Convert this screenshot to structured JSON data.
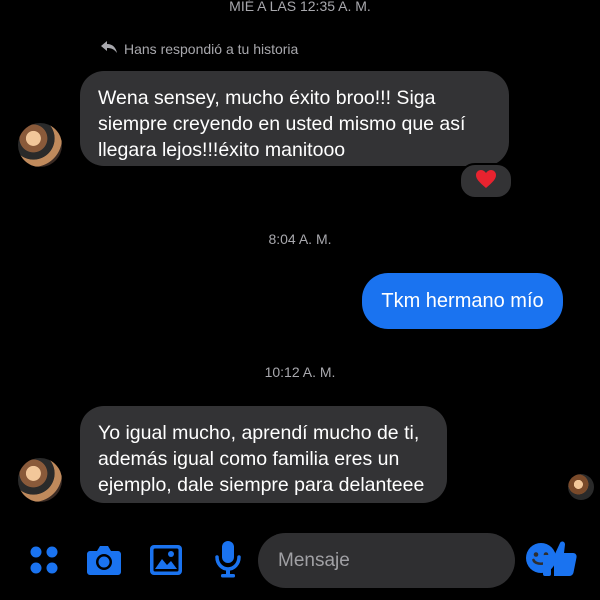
{
  "thread": {
    "top_timestamp": "MIÉ A LAS 12:35 A. M.",
    "reply_note": "Hans respondió a tu historia",
    "timestamp_2": "8:04 A. M.",
    "timestamp_3": "10:12 A. M."
  },
  "messages": [
    {
      "direction": "incoming",
      "text": "Wena sensey, mucho éxito broo!!! Siga siempre creyendo en usted mismo que así llegara lejos!!!éxito manitooo",
      "reaction": "heart"
    },
    {
      "direction": "outgoing",
      "text": "Tkm hermano mío"
    },
    {
      "direction": "incoming",
      "text": "Yo igual mucho, aprendí mucho de ti, además igual como familia eres un ejemplo, dale siempre para delanteee"
    }
  ],
  "composer": {
    "placeholder": "Mensaje"
  },
  "toolbar": {
    "icons": [
      "menu-dots-icon",
      "camera-icon",
      "gallery-icon",
      "microphone-icon",
      "emoji-icon",
      "thumbs-up-icon"
    ]
  },
  "colors": {
    "accent": "#1a73f0",
    "incoming_bubble": "#333335",
    "background": "#000000",
    "reaction_heart": "#e8232f"
  }
}
